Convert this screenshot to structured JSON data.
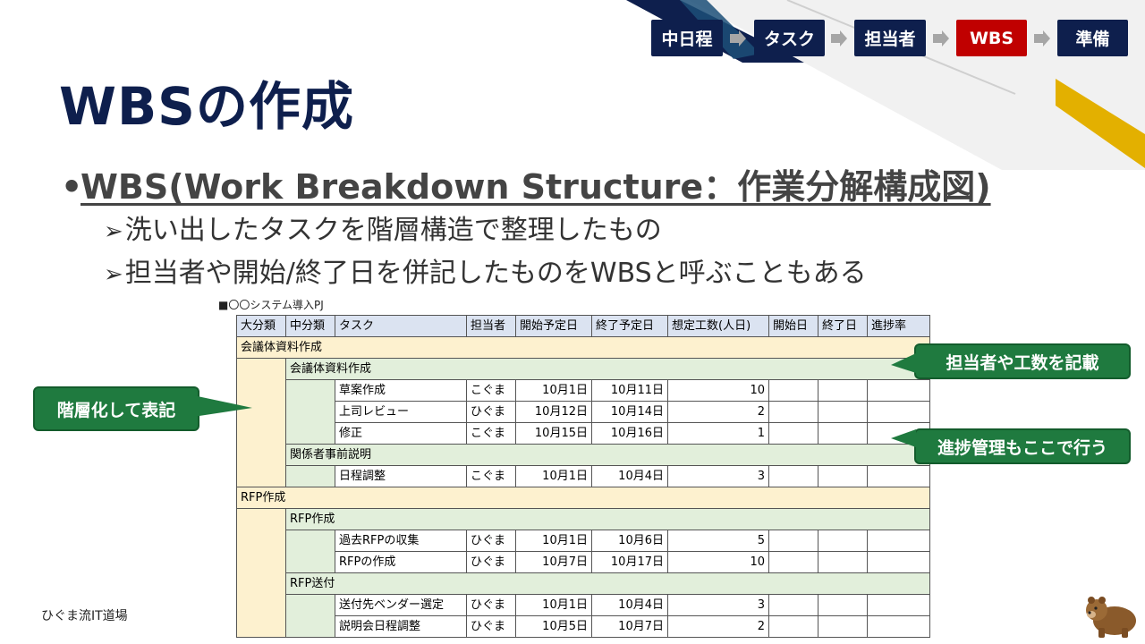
{
  "colors": {
    "navy": "#0e1f4d",
    "active_red": "#c00000",
    "gold": "#e3b000",
    "callout_green": "#1f7a3f",
    "header_blue": "#dbe3f1",
    "major_yellow": "#fdf1cf",
    "mid_green": "#e2efdb"
  },
  "stepnav": {
    "steps": [
      "中日程",
      "タスク",
      "担当者",
      "WBS",
      "準備"
    ],
    "active": "WBS"
  },
  "title": "WBSの作成",
  "bullet": {
    "marker": "•",
    "text": "WBS(Work Breakdown Structure：作業分解構成図)",
    "subs": [
      "洗い出したタスクを階層構造で整理したもの",
      "担当者や開始/終了日を併記したものをWBSと呼ぶこともある"
    ],
    "sub_marker": "➢"
  },
  "table": {
    "caption": "■〇〇システム導入PJ",
    "headers": [
      "大分類",
      "中分類",
      "タスク",
      "担当者",
      "開始予定日",
      "終了予定日",
      "想定工数(人日)",
      "開始日",
      "終了日",
      "進捗率"
    ],
    "groups": [
      {
        "major": "会議体資料作成",
        "mids": [
          {
            "mid": "会議体資料作成",
            "tasks": [
              {
                "task": "草案作成",
                "owner": "こぐま",
                "start": "10月1日",
                "end": "10月11日",
                "effort": "10"
              },
              {
                "task": "上司レビュー",
                "owner": "ひぐま",
                "start": "10月12日",
                "end": "10月14日",
                "effort": "2"
              },
              {
                "task": "修正",
                "owner": "こぐま",
                "start": "10月15日",
                "end": "10月16日",
                "effort": "1"
              }
            ]
          },
          {
            "mid": "関係者事前説明",
            "tasks": [
              {
                "task": "日程調整",
                "owner": "こぐま",
                "start": "10月1日",
                "end": "10月4日",
                "effort": "3"
              }
            ]
          }
        ]
      },
      {
        "major": "RFP作成",
        "mids": [
          {
            "mid": "RFP作成",
            "tasks": [
              {
                "task": "過去RFPの収集",
                "owner": "ひぐま",
                "start": "10月1日",
                "end": "10月6日",
                "effort": "5"
              },
              {
                "task": "RFPの作成",
                "owner": "ひぐま",
                "start": "10月7日",
                "end": "10月17日",
                "effort": "10"
              }
            ]
          },
          {
            "mid": "RFP送付",
            "tasks": [
              {
                "task": "送付先ベンダー選定",
                "owner": "ひぐま",
                "start": "10月1日",
                "end": "10月4日",
                "effort": "3"
              },
              {
                "task": "説明会日程調整",
                "owner": "ひぐま",
                "start": "10月5日",
                "end": "10月7日",
                "effort": "2"
              }
            ]
          }
        ]
      }
    ]
  },
  "callouts": {
    "hierarchy": "階層化して表記",
    "owner_effort": "担当者や工数を記載",
    "progress": "進捗管理もここで行う"
  },
  "footer": "ひぐま流IT道場"
}
